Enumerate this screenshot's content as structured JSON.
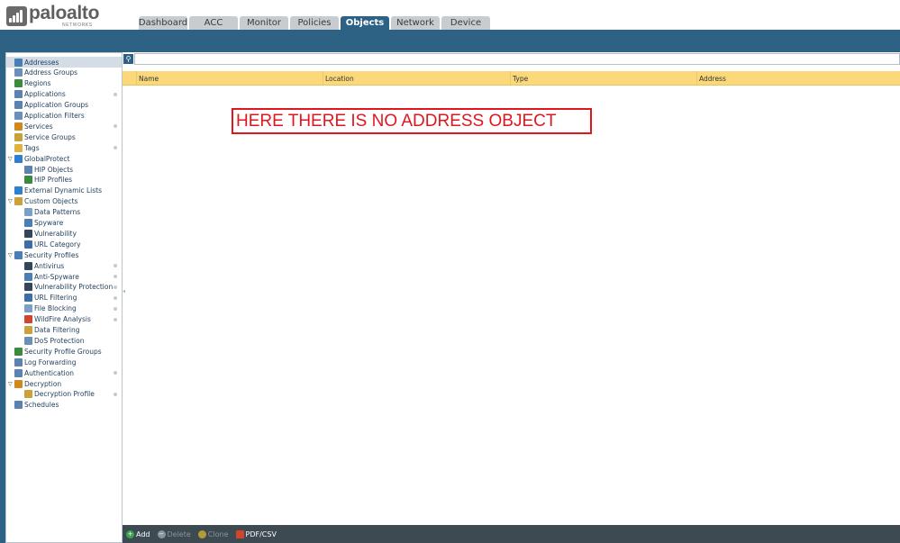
{
  "brand": {
    "name": "paloalto",
    "sub": "NETWORKS"
  },
  "tabs": [
    {
      "label": "Dashboard",
      "active": false
    },
    {
      "label": "ACC",
      "active": false
    },
    {
      "label": "Monitor",
      "active": false
    },
    {
      "label": "Policies",
      "active": false
    },
    {
      "label": "Objects",
      "active": true
    },
    {
      "label": "Network",
      "active": false
    },
    {
      "label": "Device",
      "active": false
    }
  ],
  "sidebar": {
    "items": [
      {
        "label": "Addresses",
        "indent": 0,
        "icon": "address-icon",
        "color": "#4a7fb5",
        "selected": true,
        "dot": false,
        "tri": false
      },
      {
        "label": "Address Groups",
        "indent": 0,
        "icon": "address-group-icon",
        "color": "#6a8fb8",
        "selected": false,
        "dot": false,
        "tri": false
      },
      {
        "label": "Regions",
        "indent": 0,
        "icon": "globe-icon",
        "color": "#3b8a3e",
        "selected": false,
        "dot": false,
        "tri": false
      },
      {
        "label": "Applications",
        "indent": 0,
        "icon": "application-icon",
        "color": "#5b82b0",
        "selected": false,
        "dot": true,
        "tri": false
      },
      {
        "label": "Application Groups",
        "indent": 0,
        "icon": "application-group-icon",
        "color": "#5b82b0",
        "selected": false,
        "dot": false,
        "tri": false
      },
      {
        "label": "Application Filters",
        "indent": 0,
        "icon": "application-filter-icon",
        "color": "#6a8fb8",
        "selected": false,
        "dot": false,
        "tri": false
      },
      {
        "label": "Services",
        "indent": 0,
        "icon": "services-icon",
        "color": "#d08a1c",
        "selected": false,
        "dot": true,
        "tri": false
      },
      {
        "label": "Service Groups",
        "indent": 0,
        "icon": "service-group-icon",
        "color": "#c7a23a",
        "selected": false,
        "dot": false,
        "tri": false
      },
      {
        "label": "Tags",
        "indent": 0,
        "icon": "tag-icon",
        "color": "#e0b23f",
        "selected": false,
        "dot": true,
        "tri": false
      },
      {
        "label": "GlobalProtect",
        "indent": 0,
        "icon": "globalprotect-icon",
        "color": "#2f7fd0",
        "selected": false,
        "dot": false,
        "tri": true
      },
      {
        "label": "HIP Objects",
        "indent": 1,
        "icon": "hip-object-icon",
        "color": "#5b82b0",
        "selected": false,
        "dot": false,
        "tri": false
      },
      {
        "label": "HIP Profiles",
        "indent": 1,
        "icon": "hip-profile-icon",
        "color": "#3b8a3e",
        "selected": false,
        "dot": false,
        "tri": false
      },
      {
        "label": "External Dynamic Lists",
        "indent": 0,
        "icon": "external-list-icon",
        "color": "#2f7fd0",
        "selected": false,
        "dot": false,
        "tri": false
      },
      {
        "label": "Custom Objects",
        "indent": 0,
        "icon": "custom-objects-icon",
        "color": "#c9a33a",
        "selected": false,
        "dot": false,
        "tri": true
      },
      {
        "label": "Data Patterns",
        "indent": 1,
        "icon": "data-pattern-icon",
        "color": "#7aa0c8",
        "selected": false,
        "dot": false,
        "tri": false
      },
      {
        "label": "Spyware",
        "indent": 1,
        "icon": "spyware-icon",
        "color": "#4a7fb5",
        "selected": false,
        "dot": false,
        "tri": false
      },
      {
        "label": "Vulnerability",
        "indent": 1,
        "icon": "vulnerability-icon",
        "color": "#34475a",
        "selected": false,
        "dot": false,
        "tri": false
      },
      {
        "label": "URL Category",
        "indent": 1,
        "icon": "url-category-icon",
        "color": "#3c6fa8",
        "selected": false,
        "dot": false,
        "tri": false
      },
      {
        "label": "Security Profiles",
        "indent": 0,
        "icon": "security-profiles-icon",
        "color": "#4a7fb5",
        "selected": false,
        "dot": false,
        "tri": true
      },
      {
        "label": "Antivirus",
        "indent": 1,
        "icon": "antivirus-icon",
        "color": "#34475a",
        "selected": false,
        "dot": true,
        "tri": false
      },
      {
        "label": "Anti-Spyware",
        "indent": 1,
        "icon": "anti-spyware-icon",
        "color": "#4a7fb5",
        "selected": false,
        "dot": true,
        "tri": false
      },
      {
        "label": "Vulnerability Protection",
        "indent": 1,
        "icon": "vulnerability-protection-icon",
        "color": "#34475a",
        "selected": false,
        "dot": true,
        "tri": false
      },
      {
        "label": "URL Filtering",
        "indent": 1,
        "icon": "url-filtering-icon",
        "color": "#3c6fa8",
        "selected": false,
        "dot": true,
        "tri": false
      },
      {
        "label": "File Blocking",
        "indent": 1,
        "icon": "file-blocking-icon",
        "color": "#7aa0c8",
        "selected": false,
        "dot": true,
        "tri": false
      },
      {
        "label": "WildFire Analysis",
        "indent": 1,
        "icon": "wildfire-icon",
        "color": "#d0452b",
        "selected": false,
        "dot": true,
        "tri": false
      },
      {
        "label": "Data Filtering",
        "indent": 1,
        "icon": "data-filtering-icon",
        "color": "#c9a33a",
        "selected": false,
        "dot": false,
        "tri": false
      },
      {
        "label": "DoS Protection",
        "indent": 1,
        "icon": "dos-protection-icon",
        "color": "#6a8fb8",
        "selected": false,
        "dot": false,
        "tri": false
      },
      {
        "label": "Security Profile Groups",
        "indent": 0,
        "icon": "security-profile-group-icon",
        "color": "#3b8a3e",
        "selected": false,
        "dot": false,
        "tri": false
      },
      {
        "label": "Log Forwarding",
        "indent": 0,
        "icon": "log-forwarding-icon",
        "color": "#5b82b0",
        "selected": false,
        "dot": false,
        "tri": false
      },
      {
        "label": "Authentication",
        "indent": 0,
        "icon": "authentication-icon",
        "color": "#5b82b0",
        "selected": false,
        "dot": true,
        "tri": false
      },
      {
        "label": "Decryption",
        "indent": 0,
        "icon": "decryption-icon",
        "color": "#d08a1c",
        "selected": false,
        "dot": false,
        "tri": true
      },
      {
        "label": "Decryption Profile",
        "indent": 1,
        "icon": "decryption-profile-icon",
        "color": "#c9a33a",
        "selected": false,
        "dot": true,
        "tri": false
      },
      {
        "label": "Schedules",
        "indent": 0,
        "icon": "schedule-icon",
        "color": "#5b82b0",
        "selected": false,
        "dot": false,
        "tri": false
      }
    ]
  },
  "search": {
    "placeholder": ""
  },
  "table": {
    "columns": [
      "Name",
      "Location",
      "Type",
      "Address"
    ]
  },
  "annotation": {
    "text": "HERE THERE IS NO ADDRESS OBJECT"
  },
  "actions": [
    {
      "label": "Add",
      "icon": "add-icon",
      "enabled": true,
      "color": "#3ba44a",
      "glyph": "+"
    },
    {
      "label": "Delete",
      "icon": "delete-icon",
      "enabled": false,
      "color": "#8a949b",
      "glyph": "−"
    },
    {
      "label": "Clone",
      "icon": "clone-icon",
      "enabled": false,
      "color": "#b59a3a",
      "glyph": ""
    },
    {
      "label": "PDF/CSV",
      "icon": "pdf-csv-icon",
      "enabled": true,
      "color": "#d0452b",
      "glyph": ""
    }
  ],
  "colors": {
    "accent": "#2e6285",
    "header_row": "#fbd97a",
    "annotation": "#e0161f"
  }
}
